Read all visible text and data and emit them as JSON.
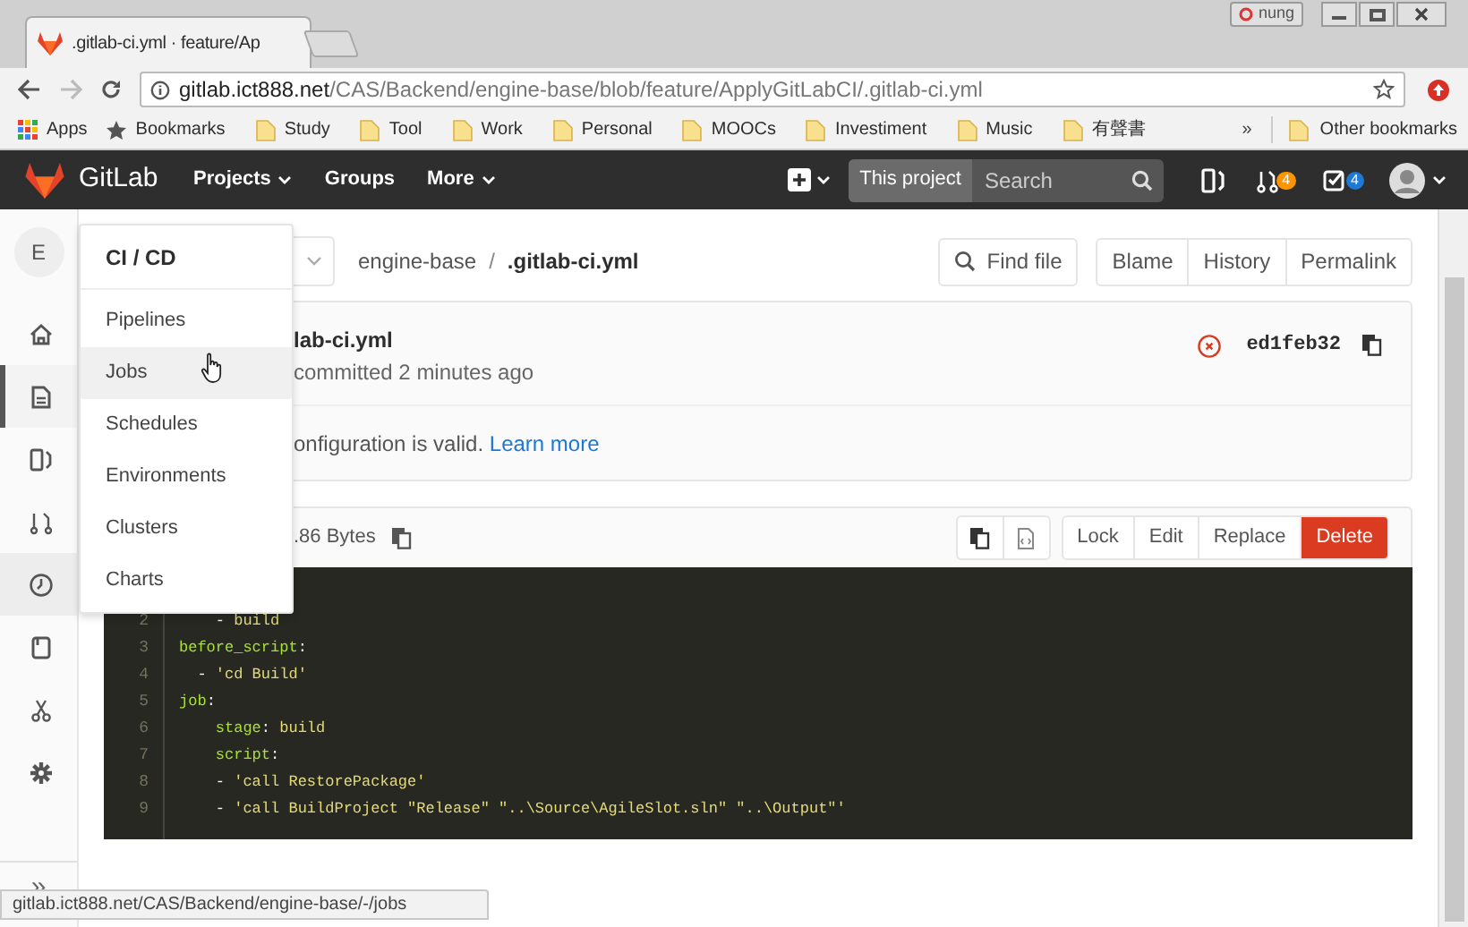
{
  "browser": {
    "tab_title": ".gitlab-ci.yml · feature/Ap",
    "profile": "nung",
    "address": {
      "host": "gitlab.ict888.net",
      "path": "/CAS/Backend/engine-base/blob/feature/ApplyGitLabCI/.gitlab-ci.yml"
    },
    "bookmarks": [
      {
        "label": "Apps",
        "kind": "apps"
      },
      {
        "label": "Bookmarks",
        "kind": "star"
      },
      {
        "label": "Study",
        "kind": "folder"
      },
      {
        "label": "Tool",
        "kind": "folder"
      },
      {
        "label": "Work",
        "kind": "folder"
      },
      {
        "label": "Personal",
        "kind": "folder"
      },
      {
        "label": "MOOCs",
        "kind": "folder"
      },
      {
        "label": "Investiment",
        "kind": "folder"
      },
      {
        "label": "Music",
        "kind": "folder"
      },
      {
        "label": "有聲書",
        "kind": "folder"
      }
    ],
    "bookmarks_overflow": "»",
    "other_bookmarks": "Other bookmarks"
  },
  "navbar": {
    "logo": "GitLab",
    "menus": [
      {
        "label": "Projects",
        "caret": true
      },
      {
        "label": "Groups",
        "caret": false
      },
      {
        "label": "More",
        "caret": true
      }
    ],
    "search_scope": "This project",
    "search_placeholder": "Search",
    "merge_requests_count": "4",
    "todos_count": "4"
  },
  "sidebar": {
    "avatar_letter": "E",
    "items": [
      {
        "kind": "home",
        "selected": false,
        "hovered": false
      },
      {
        "kind": "repository",
        "selected": true,
        "hovered": false
      },
      {
        "kind": "board",
        "selected": false,
        "hovered": false
      },
      {
        "kind": "merge",
        "selected": false,
        "hovered": false
      },
      {
        "kind": "pipeline",
        "selected": false,
        "hovered": true
      },
      {
        "kind": "wiki",
        "selected": false,
        "hovered": false
      },
      {
        "kind": "snippets",
        "selected": false,
        "hovered": false
      },
      {
        "kind": "settings",
        "selected": false,
        "hovered": false
      }
    ],
    "collapse": "»"
  },
  "ci_menu": {
    "title": "CI / CD",
    "items": [
      {
        "label": "Pipelines",
        "highlighted": false
      },
      {
        "label": "Jobs",
        "highlighted": true
      },
      {
        "label": "Schedules",
        "highlighted": false
      },
      {
        "label": "Environments",
        "highlighted": false
      },
      {
        "label": "Clusters",
        "highlighted": false
      },
      {
        "label": "Charts",
        "highlighted": false
      }
    ]
  },
  "breadcrumb": {
    "project": "engine-base",
    "separator": "/",
    "file": ".gitlab-ci.yml"
  },
  "file_nav_buttons": {
    "find": "Find file",
    "group": [
      "Blame",
      "History",
      "Permalink"
    ]
  },
  "commit": {
    "title": "lab-ci.yml",
    "meta": "committed 2 minutes ago",
    "pipeline_failed": true,
    "sha": "ed1feb32"
  },
  "ci_notice": {
    "text": "onfiguration is valid. ",
    "link": "Learn more"
  },
  "file": {
    "size": ".86 Bytes",
    "actions": [
      {
        "label": "Lock",
        "kind": "default"
      },
      {
        "label": "Edit",
        "kind": "default"
      },
      {
        "label": "Replace",
        "kind": "default"
      },
      {
        "label": "Delete",
        "kind": "danger"
      }
    ]
  },
  "code": [
    {
      "num": "2",
      "tokens": [
        {
          "text": "    - ",
          "kind": "plain"
        },
        {
          "text": "build",
          "kind": "string"
        }
      ]
    },
    {
      "num": "3",
      "tokens": [
        {
          "text": "before_script",
          "kind": "key"
        },
        {
          "text": ":",
          "kind": "plain"
        }
      ]
    },
    {
      "num": "4",
      "tokens": [
        {
          "text": "  - ",
          "kind": "plain"
        },
        {
          "text": "'cd Build'",
          "kind": "string"
        }
      ]
    },
    {
      "num": "5",
      "tokens": [
        {
          "text": "job",
          "kind": "key"
        },
        {
          "text": ":",
          "kind": "plain"
        }
      ]
    },
    {
      "num": "6",
      "tokens": [
        {
          "text": "    stage",
          "kind": "key"
        },
        {
          "text": ": ",
          "kind": "plain"
        },
        {
          "text": "build",
          "kind": "string"
        }
      ]
    },
    {
      "num": "7",
      "tokens": [
        {
          "text": "    script",
          "kind": "key"
        },
        {
          "text": ":",
          "kind": "plain"
        }
      ]
    },
    {
      "num": "8",
      "tokens": [
        {
          "text": "    - ",
          "kind": "plain"
        },
        {
          "text": "'call RestorePackage'",
          "kind": "string"
        }
      ]
    },
    {
      "num": "9",
      "tokens": [
        {
          "text": "    - ",
          "kind": "plain"
        },
        {
          "text": "'call BuildProject \"Release\" \"..\\Source\\AgileSlot.sln\" \"..\\Output\"'",
          "kind": "string"
        }
      ]
    }
  ],
  "status_url": "gitlab.ict888.net/CAS/Backend/engine-base/-/jobs"
}
